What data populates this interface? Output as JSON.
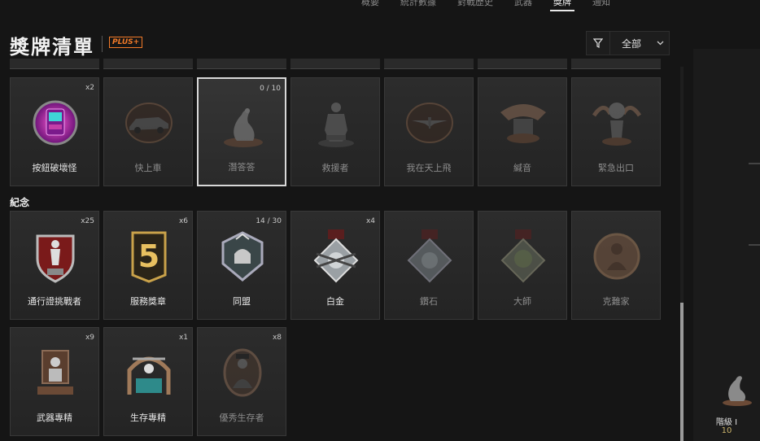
{
  "nav": {
    "tabs": [
      "概要",
      "統計數據",
      "對戰歷史",
      "武器",
      "獎牌",
      "通知"
    ],
    "active": 4
  },
  "page": {
    "title": "獎牌清單",
    "badge": "PLUS+"
  },
  "filter": {
    "label": "全部"
  },
  "section2": {
    "label": "紀念"
  },
  "row1": [
    {
      "label": "按鈕破壞怪",
      "count": "x2",
      "icon": "arcade-machine-icon",
      "locked": false
    },
    {
      "label": "快上車",
      "count": "",
      "icon": "car-icon",
      "locked": true
    },
    {
      "label": "潛答答",
      "count": "0 / 10",
      "icon": "seal-icon",
      "locked": true,
      "selected": true
    },
    {
      "label": "救援者",
      "count": "",
      "icon": "rescuer-statue-icon",
      "locked": true
    },
    {
      "label": "我在天上飛",
      "count": "",
      "icon": "glider-icon",
      "locked": true
    },
    {
      "label": "緘音",
      "count": "",
      "icon": "winged-crest-icon",
      "locked": true
    },
    {
      "label": "緊急出口",
      "count": "",
      "icon": "parachute-crest-icon",
      "locked": true
    }
  ],
  "row2": [
    {
      "label": "通行證挑戰者",
      "count": "x25",
      "icon": "shield-soldier-icon",
      "locked": false
    },
    {
      "label": "服務獎章",
      "count": "x6",
      "icon": "service-five-icon",
      "locked": false
    },
    {
      "label": "同盟",
      "count": "14 / 30",
      "icon": "alliance-fist-icon",
      "locked": false
    },
    {
      "label": "白金",
      "count": "x4",
      "icon": "platinum-medal-icon",
      "locked": false
    },
    {
      "label": "鑽石",
      "count": "",
      "icon": "diamond-medal-icon",
      "locked": true
    },
    {
      "label": "大師",
      "count": "",
      "icon": "master-medal-icon",
      "locked": true
    },
    {
      "label": "克難家",
      "count": "",
      "icon": "coin-portrait-icon",
      "locked": true
    }
  ],
  "row3": [
    {
      "label": "武器專精",
      "count": "x9",
      "icon": "throne-icon",
      "locked": false
    },
    {
      "label": "生存專精",
      "count": "x1",
      "icon": "survival-arch-icon",
      "locked": false
    },
    {
      "label": "優秀生存者",
      "count": "x8",
      "icon": "survivor-portrait-icon",
      "locked": true
    }
  ],
  "rank": {
    "label": "階級 I",
    "value": "10",
    "icon": "seal-rank-icon"
  },
  "colors": {
    "accent": "#f27a28",
    "card": "#2a2a2a",
    "background": "#151515",
    "rank": "#c9b26a"
  }
}
